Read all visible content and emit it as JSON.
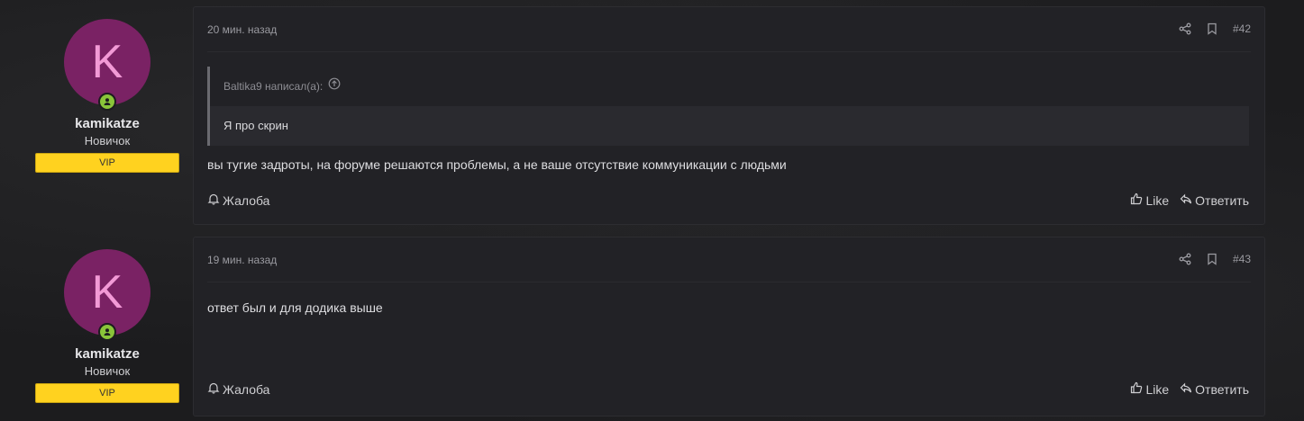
{
  "posts": [
    {
      "user": {
        "avatar_letter": "K",
        "name": "kamikatze",
        "title": "Новичок",
        "badge": "VIP"
      },
      "time": "20 мин. назад",
      "number": "#42",
      "quote": {
        "author": "Baltika9 написал(а):",
        "text": "Я про скрин"
      },
      "message": "вы тугие задроты, на форуме решаются проблемы, а не ваше отсутствие коммуникации с людьми",
      "report_label": "Жалоба",
      "like_label": "Like",
      "reply_label": "Ответить"
    },
    {
      "user": {
        "avatar_letter": "K",
        "name": "kamikatze",
        "title": "Новичок",
        "badge": "VIP"
      },
      "time": "19 мин. назад",
      "number": "#43",
      "message": "ответ был и для додика выше",
      "report_label": "Жалоба",
      "like_label": "Like",
      "reply_label": "Ответить"
    }
  ],
  "colors": {
    "avatar_bg": "#7a2264",
    "vip_badge": "#ffd21f",
    "online": "#8ac43a",
    "card_bg": "#222226"
  },
  "icons": [
    "share-icon",
    "bookmark-icon",
    "arrow-up-circle-icon",
    "bell-icon",
    "thumbs-up-icon",
    "reply-icon",
    "user-icon"
  ]
}
